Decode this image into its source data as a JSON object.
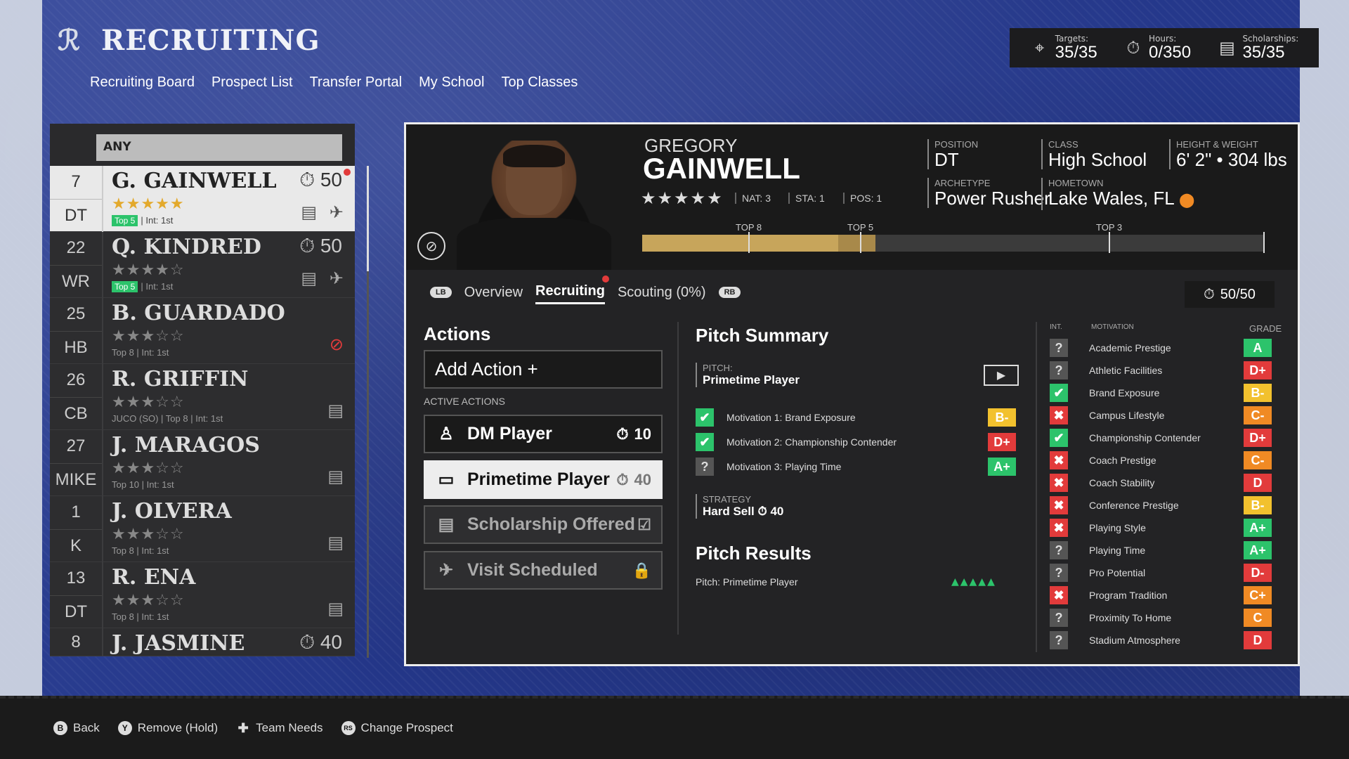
{
  "header": {
    "title": "RECRUITING",
    "nav": [
      "Recruiting Board",
      "Prospect List",
      "Transfer Portal",
      "My School",
      "Top Classes"
    ]
  },
  "stats": [
    {
      "label": "Targets:",
      "value": "35/35",
      "icon": "crosshair-icon"
    },
    {
      "label": "Hours:",
      "value": "0/350",
      "icon": "stopwatch-icon"
    },
    {
      "label": "Scholarships:",
      "value": "35/35",
      "icon": "document-icon"
    }
  ],
  "filter": "ANY",
  "prospects": [
    {
      "num": "7",
      "pos": "DT",
      "name": "G. GAINWELL",
      "stars": "★★★★★",
      "meta_badge": "Top 5",
      "meta": "| Int: 1st",
      "hours": "50"
    },
    {
      "num": "22",
      "pos": "WR",
      "name": "Q. KINDRED",
      "stars": "★★★★☆",
      "meta_badge": "Top 5",
      "meta": "| Int: 1st",
      "hours": "50"
    },
    {
      "num": "25",
      "pos": "HB",
      "name": "B. GUARDADO",
      "stars": "★★★☆☆",
      "meta_badge": "",
      "meta": "Top 8 | Int: 1st",
      "hours": ""
    },
    {
      "num": "26",
      "pos": "CB",
      "name": "R. GRIFFIN",
      "stars": "★★★☆☆",
      "meta_badge": "",
      "meta": "JUCO (SO) | Top 8 | Int: 1st",
      "hours": ""
    },
    {
      "num": "27",
      "pos": "MIKE",
      "name": "J. MARAGOS",
      "stars": "★★★☆☆",
      "meta_badge": "",
      "meta": "Top 10 | Int: 1st",
      "hours": ""
    },
    {
      "num": "1",
      "pos": "K",
      "name": "J. OLVERA",
      "stars": "★★★☆☆",
      "meta_badge": "",
      "meta": "Top 8 | Int: 1st",
      "hours": ""
    },
    {
      "num": "13",
      "pos": "DT",
      "name": "R. ENA",
      "stars": "★★★☆☆",
      "meta_badge": "",
      "meta": "Top 8 | Int: 1st",
      "hours": ""
    },
    {
      "num": "8",
      "pos": "",
      "name": "J. JASMINE",
      "stars": "",
      "meta_badge": "",
      "meta": "",
      "hours": "40"
    }
  ],
  "player": {
    "first": "GREGORY",
    "last": "GAINWELL",
    "stars": "★★★★★",
    "nat": "NAT: 3",
    "sta": "STA: 1",
    "pos": "POS: 1",
    "position_label": "POSITION",
    "position": "DT",
    "class_label": "CLASS",
    "class": "High School",
    "hw_label": "HEIGHT & WEIGHT",
    "hw": "6' 2\" • 304 lbs",
    "arch_label": "ARCHETYPE",
    "archetype": "Power Rusher",
    "home_label": "HOMETOWN",
    "hometown": "Lake Wales, FL",
    "progress": {
      "top8": "TOP 8",
      "top5": "TOP 5",
      "top3": "TOP 3"
    }
  },
  "tabs": {
    "lb": "LB",
    "overview": "Overview",
    "recruiting": "Recruiting",
    "scouting": "Scouting (0%)",
    "rb": "RB"
  },
  "hours_box": "50/50",
  "actions": {
    "title": "Actions",
    "add": "Add Action +",
    "active_label": "ACTIVE ACTIONS",
    "items": [
      {
        "label": "DM Player",
        "cost": "10"
      },
      {
        "label": "Primetime Player",
        "cost": "40"
      },
      {
        "label": "Scholarship Offered",
        "cost": "☑"
      },
      {
        "label": "Visit Scheduled",
        "cost": "🔒"
      }
    ]
  },
  "pitch": {
    "title": "Pitch Summary",
    "pitch_label": "PITCH:",
    "pitch": "Primetime Player",
    "motivations": [
      {
        "label": "Motivation 1: Brand Exposure",
        "grade": "B-",
        "color": "#f2c12e",
        "status": "ok"
      },
      {
        "label": "Motivation 2: Championship Contender",
        "grade": "D+",
        "color": "#e23b3b",
        "status": "ok"
      },
      {
        "label": "Motivation 3: Playing Time",
        "grade": "A+",
        "color": "#2cc36b",
        "status": "q"
      }
    ],
    "strategy_label": "STRATEGY",
    "strategy": "Hard Sell",
    "strategy_cost": "40",
    "results_title": "Pitch Results",
    "result": "Pitch: Primetime Player",
    "arrows": "▲▲▲▲▲"
  },
  "grades": {
    "hdr_int": "INT.",
    "hdr_mot": "MOTIVATION",
    "hdr_grade": "GRADE",
    "rows": [
      {
        "name": "Academic Prestige",
        "status": "q",
        "grade": "A",
        "color": "#2cc36b"
      },
      {
        "name": "Athletic Facilities",
        "status": "q",
        "grade": "D+",
        "color": "#e23b3b"
      },
      {
        "name": "Brand Exposure",
        "status": "ok",
        "grade": "B-",
        "color": "#f2c12e"
      },
      {
        "name": "Campus Lifestyle",
        "status": "no",
        "grade": "C-",
        "color": "#f08a24"
      },
      {
        "name": "Championship Contender",
        "status": "ok",
        "grade": "D+",
        "color": "#e23b3b"
      },
      {
        "name": "Coach Prestige",
        "status": "no",
        "grade": "C-",
        "color": "#f08a24"
      },
      {
        "name": "Coach Stability",
        "status": "no",
        "grade": "D",
        "color": "#e23b3b"
      },
      {
        "name": "Conference Prestige",
        "status": "no",
        "grade": "B-",
        "color": "#f2c12e"
      },
      {
        "name": "Playing Style",
        "status": "no",
        "grade": "A+",
        "color": "#2cc36b"
      },
      {
        "name": "Playing Time",
        "status": "q",
        "grade": "A+",
        "color": "#2cc36b"
      },
      {
        "name": "Pro Potential",
        "status": "q",
        "grade": "D-",
        "color": "#e23b3b"
      },
      {
        "name": "Program Tradition",
        "status": "no",
        "grade": "C+",
        "color": "#f08a24"
      },
      {
        "name": "Proximity To Home",
        "status": "q",
        "grade": "C",
        "color": "#f08a24"
      },
      {
        "name": "Stadium Atmosphere",
        "status": "q",
        "grade": "D",
        "color": "#e23b3b"
      }
    ]
  },
  "footer": [
    {
      "btn": "B",
      "label": "Back"
    },
    {
      "btn": "Y",
      "label": "Remove (Hold)"
    },
    {
      "btn": "✚",
      "label": "Team Needs"
    },
    {
      "btn": "RS",
      "label": "Change Prospect"
    }
  ]
}
